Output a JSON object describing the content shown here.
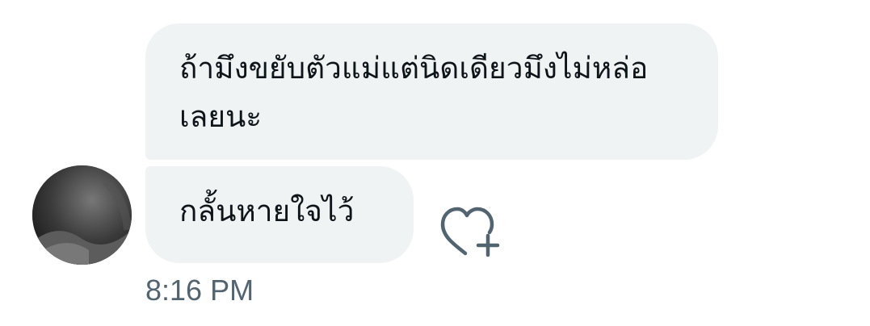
{
  "messages": [
    {
      "text": "ถ้ามึงขยับตัวแม่แต่นิดเดียวมึงไม่หล่อเลยนะ"
    },
    {
      "text": "กลั้นหายใจไว้"
    }
  ],
  "timestamp": "8:16 PM",
  "icons": {
    "avatar": "avatar-photo",
    "reaction": "heart-plus-icon"
  },
  "colors": {
    "bubble": "#eff3f4",
    "text": "#0f1419",
    "timestamp": "#536471",
    "icon": "#536471"
  }
}
